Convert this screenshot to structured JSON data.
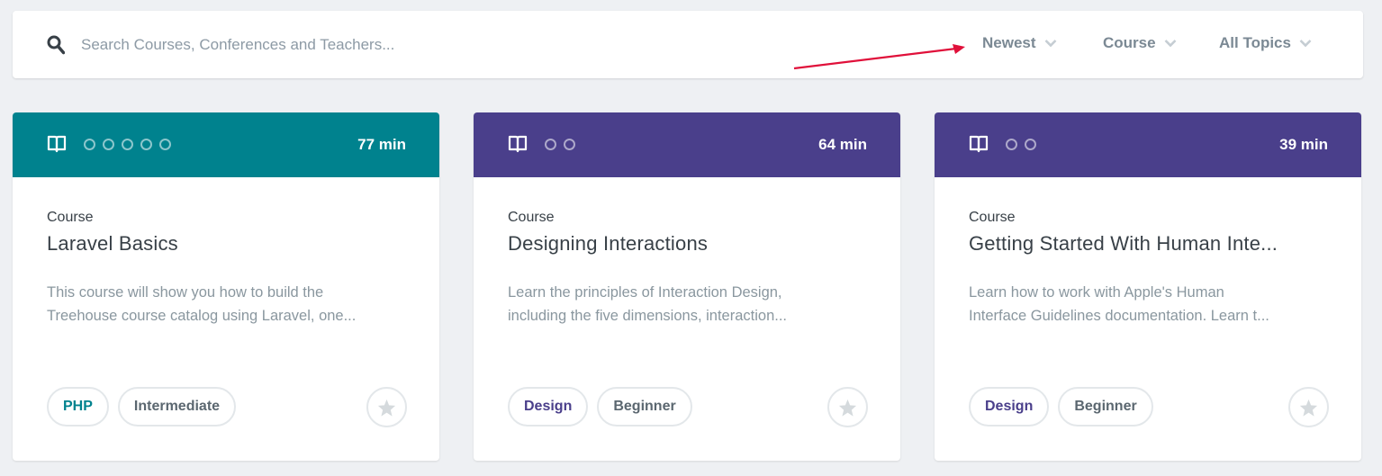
{
  "search": {
    "placeholder": "Search Courses, Conferences and Teachers..."
  },
  "filters": [
    {
      "label": "Newest"
    },
    {
      "label": "Course"
    },
    {
      "label": "All Topics"
    }
  ],
  "cards": [
    {
      "color": "#00828e",
      "level_dots": 5,
      "duration": "77 min",
      "type": "Course",
      "title": "Laravel Basics",
      "desc1": "This course will show you how to build the",
      "desc2": "Treehouse course catalog using Laravel, one...",
      "topic": "PHP",
      "topic_color": "#00828e",
      "level": "Intermediate"
    },
    {
      "color": "#4a3f8b",
      "level_dots": 2,
      "duration": "64 min",
      "type": "Course",
      "title": "Designing Interactions",
      "desc1": "Learn the principles of Interaction Design,",
      "desc2": "including the five dimensions, interaction...",
      "topic": "Design",
      "topic_color": "#4a3f8b",
      "level": "Beginner"
    },
    {
      "color": "#4a3f8b",
      "level_dots": 2,
      "duration": "39 min",
      "type": "Course",
      "title": "Getting Started With Human Inte...",
      "desc1": "Learn how to work with Apple's Human",
      "desc2": "Interface Guidelines documentation. Learn t...",
      "topic": "Design",
      "topic_color": "#4a3f8b",
      "level": "Beginner"
    }
  ],
  "annotation": {
    "arrow_color": "#e0103a"
  }
}
